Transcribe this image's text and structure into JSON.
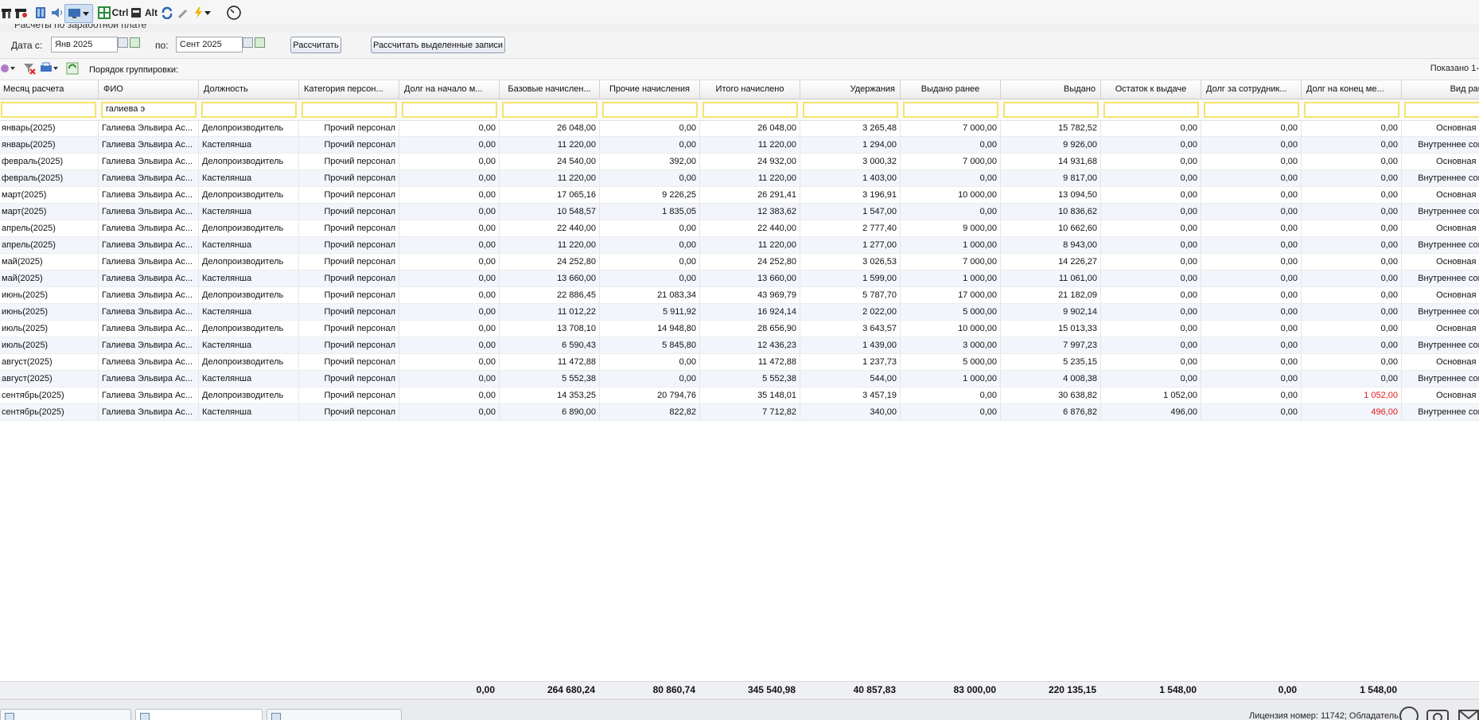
{
  "toolbar": {
    "ctrl_label": "Ctrl",
    "alt_label": "Alt",
    "icons": [
      "tools-icon",
      "tools2-icon",
      "book-icon",
      "speaker-icon",
      "monitor-icon",
      "dropdown-arrow-icon",
      "grid-icon",
      "ctrl-key",
      "spy-icon",
      "alt-key",
      "refresh-icon",
      "wrench-icon",
      "lightning-icon",
      "dropdown-arrow-icon",
      "clock-icon"
    ]
  },
  "section_title": "Расчеты по заработной плате",
  "dates": {
    "from_label": "Дата с:",
    "from_value": "Янв 2025",
    "to_label": "по:",
    "to_value": "Сент 2025",
    "calc_button": "Рассчитать",
    "calc_selected_button": "Рассчитать выделенные записи"
  },
  "grouping": {
    "label": "Порядок группировки:",
    "shown_text": "Показано 1-"
  },
  "columns": [
    "Месяц расчета",
    "ФИО",
    "Должность",
    "Категория персон...",
    "Долг на начало м...",
    "Базовые начислен...",
    "Прочие начисления",
    "Итого начислено",
    "Удержания",
    "Выдано ранее",
    "Выдано",
    "Остаток к выдаче",
    "Долг за сотрудник...",
    "Долг на конец ме...",
    "Вид работ"
  ],
  "filters": [
    "",
    "галиева э",
    "",
    "",
    "",
    "",
    "",
    "",
    "",
    "",
    "",
    "",
    "",
    "",
    ""
  ],
  "rows": [
    [
      "январь(2025)",
      "Галиева Эльвира Ас...",
      "Делопроизводитель",
      "Прочий персонал",
      "0,00",
      "26 048,00",
      "0,00",
      "26 048,00",
      "3 265,48",
      "7 000,00",
      "15 782,52",
      "0,00",
      "0,00",
      "0,00",
      "Основная раб"
    ],
    [
      "январь(2025)",
      "Галиева Эльвира Ас...",
      "Кастелянша",
      "Прочий персонал",
      "0,00",
      "11 220,00",
      "0,00",
      "11 220,00",
      "1 294,00",
      "0,00",
      "9 926,00",
      "0,00",
      "0,00",
      "0,00",
      "Внутреннее совме"
    ],
    [
      "февраль(2025)",
      "Галиева Эльвира Ас...",
      "Делопроизводитель",
      "Прочий персонал",
      "0,00",
      "24 540,00",
      "392,00",
      "24 932,00",
      "3 000,32",
      "7 000,00",
      "14 931,68",
      "0,00",
      "0,00",
      "0,00",
      "Основная раб"
    ],
    [
      "февраль(2025)",
      "Галиева Эльвира Ас...",
      "Кастелянша",
      "Прочий персонал",
      "0,00",
      "11 220,00",
      "0,00",
      "11 220,00",
      "1 403,00",
      "0,00",
      "9 817,00",
      "0,00",
      "0,00",
      "0,00",
      "Внутреннее совме"
    ],
    [
      "март(2025)",
      "Галиева Эльвира Ас...",
      "Делопроизводитель",
      "Прочий персонал",
      "0,00",
      "17 065,16",
      "9 226,25",
      "26 291,41",
      "3 196,91",
      "10 000,00",
      "13 094,50",
      "0,00",
      "0,00",
      "0,00",
      "Основная раб"
    ],
    [
      "март(2025)",
      "Галиева Эльвира Ас...",
      "Кастелянша",
      "Прочий персонал",
      "0,00",
      "10 548,57",
      "1 835,05",
      "12 383,62",
      "1 547,00",
      "0,00",
      "10 836,62",
      "0,00",
      "0,00",
      "0,00",
      "Внутреннее совме"
    ],
    [
      "апрель(2025)",
      "Галиева Эльвира Ас...",
      "Делопроизводитель",
      "Прочий персонал",
      "0,00",
      "22 440,00",
      "0,00",
      "22 440,00",
      "2 777,40",
      "9 000,00",
      "10 662,60",
      "0,00",
      "0,00",
      "0,00",
      "Основная раб"
    ],
    [
      "апрель(2025)",
      "Галиева Эльвира Ас...",
      "Кастелянша",
      "Прочий персонал",
      "0,00",
      "11 220,00",
      "0,00",
      "11 220,00",
      "1 277,00",
      "1 000,00",
      "8 943,00",
      "0,00",
      "0,00",
      "0,00",
      "Внутреннее совме"
    ],
    [
      "май(2025)",
      "Галиева Эльвира Ас...",
      "Делопроизводитель",
      "Прочий персонал",
      "0,00",
      "24 252,80",
      "0,00",
      "24 252,80",
      "3 026,53",
      "7 000,00",
      "14 226,27",
      "0,00",
      "0,00",
      "0,00",
      "Основная раб"
    ],
    [
      "май(2025)",
      "Галиева Эльвира Ас...",
      "Кастелянша",
      "Прочий персонал",
      "0,00",
      "13 660,00",
      "0,00",
      "13 660,00",
      "1 599,00",
      "1 000,00",
      "11 061,00",
      "0,00",
      "0,00",
      "0,00",
      "Внутреннее совме"
    ],
    [
      "июнь(2025)",
      "Галиева Эльвира Ас...",
      "Делопроизводитель",
      "Прочий персонал",
      "0,00",
      "22 886,45",
      "21 083,34",
      "43 969,79",
      "5 787,70",
      "17 000,00",
      "21 182,09",
      "0,00",
      "0,00",
      "0,00",
      "Основная раб"
    ],
    [
      "июнь(2025)",
      "Галиева Эльвира Ас...",
      "Кастелянша",
      "Прочий персонал",
      "0,00",
      "11 012,22",
      "5 911,92",
      "16 924,14",
      "2 022,00",
      "5 000,00",
      "9 902,14",
      "0,00",
      "0,00",
      "0,00",
      "Внутреннее совме"
    ],
    [
      "июль(2025)",
      "Галиева Эльвира Ас...",
      "Делопроизводитель",
      "Прочий персонал",
      "0,00",
      "13 708,10",
      "14 948,80",
      "28 656,90",
      "3 643,57",
      "10 000,00",
      "15 013,33",
      "0,00",
      "0,00",
      "0,00",
      "Основная раб"
    ],
    [
      "июль(2025)",
      "Галиева Эльвира Ас...",
      "Кастелянша",
      "Прочий персонал",
      "0,00",
      "6 590,43",
      "5 845,80",
      "12 436,23",
      "1 439,00",
      "3 000,00",
      "7 997,23",
      "0,00",
      "0,00",
      "0,00",
      "Внутреннее совме"
    ],
    [
      "август(2025)",
      "Галиева Эльвира Ас...",
      "Делопроизводитель",
      "Прочий персонал",
      "0,00",
      "11 472,88",
      "0,00",
      "11 472,88",
      "1 237,73",
      "5 000,00",
      "5 235,15",
      "0,00",
      "0,00",
      "0,00",
      "Основная раб"
    ],
    [
      "август(2025)",
      "Галиева Эльвира Ас...",
      "Кастелянша",
      "Прочий персонал",
      "0,00",
      "5 552,38",
      "0,00",
      "5 552,38",
      "544,00",
      "1 000,00",
      "4 008,38",
      "0,00",
      "0,00",
      "0,00",
      "Внутреннее совме"
    ],
    [
      "сентябрь(2025)",
      "Галиева Эльвира Ас...",
      "Делопроизводитель",
      "Прочий персонал",
      "0,00",
      "14 353,25",
      "20 794,76",
      "35 148,01",
      "3 457,19",
      "0,00",
      "30 638,82",
      "1 052,00",
      "0,00",
      "1 052,00",
      "Основная раб"
    ],
    [
      "сентябрь(2025)",
      "Галиева Эльвира Ас...",
      "Кастелянша",
      "Прочий персонал",
      "0,00",
      "6 890,00",
      "822,82",
      "7 712,82",
      "340,00",
      "0,00",
      "6 876,82",
      "496,00",
      "0,00",
      "496,00",
      "Внутреннее совме"
    ]
  ],
  "totals": [
    "0,00",
    "264 680,24",
    "80 860,74",
    "345 540,98",
    "40 857,83",
    "83 000,00",
    "220 135,15",
    "1 548,00",
    "0,00",
    "1 548,00"
  ],
  "status": {
    "tabs": [
      "",
      "",
      ""
    ],
    "license": "Лицензия номер: 11742; Обладатель:"
  },
  "colors": {
    "accent_red": "#e01818",
    "filter_border": "#f4e36a",
    "row_alt": "#f2f5fb"
  }
}
